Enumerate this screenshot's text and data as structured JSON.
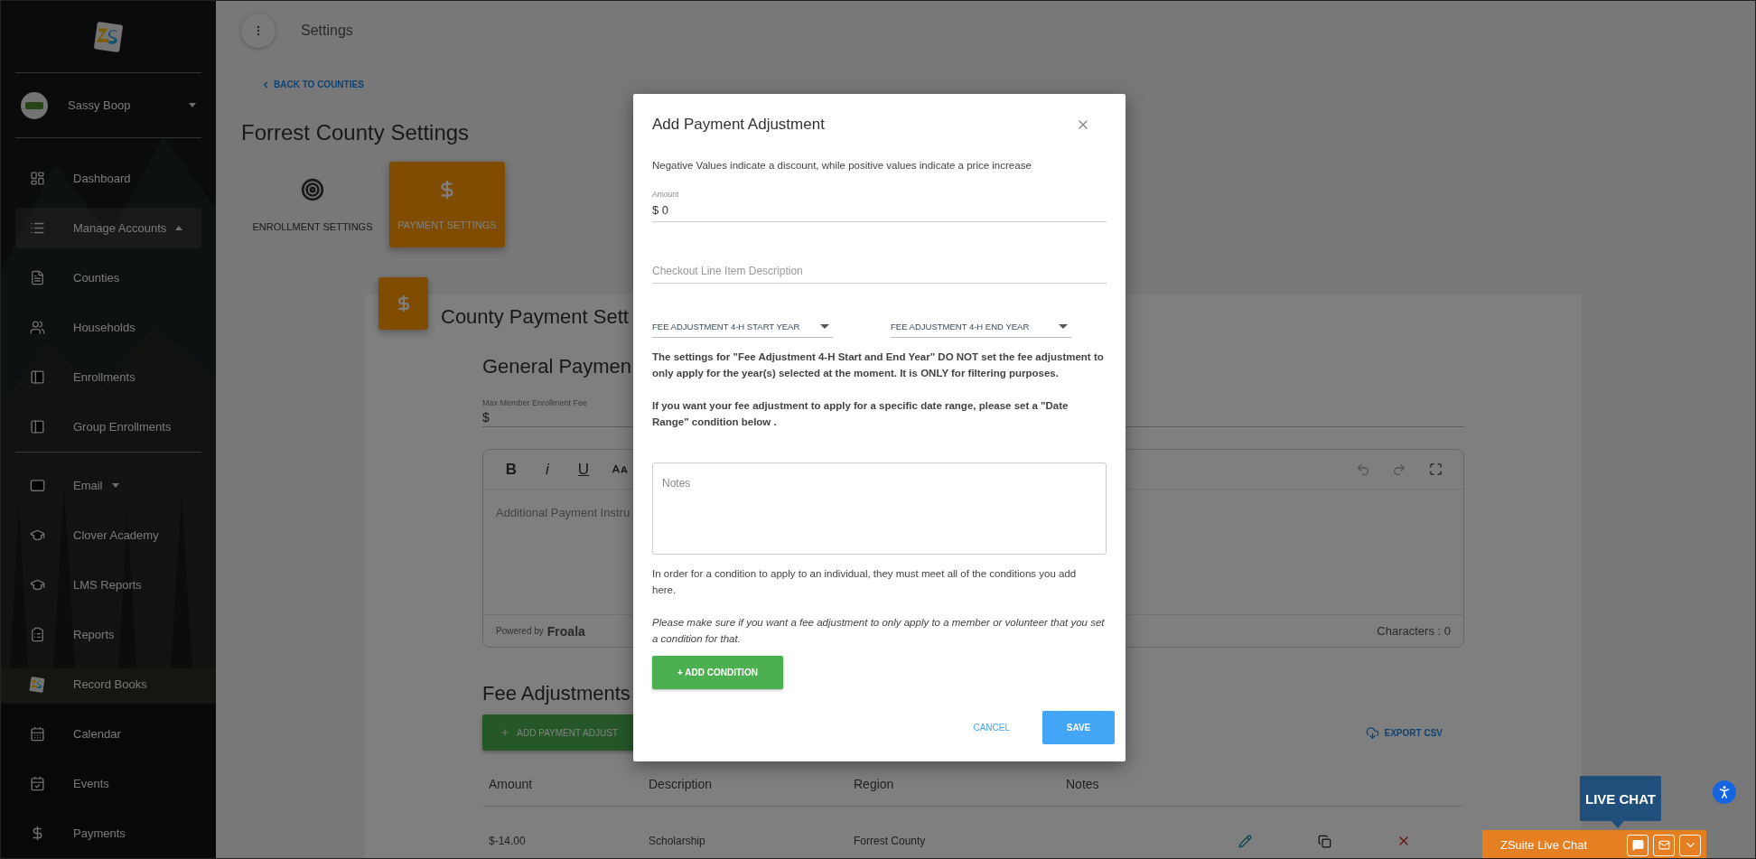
{
  "sidebar": {
    "user": {
      "name": "Sassy Boop"
    },
    "items": [
      {
        "label": "Dashboard",
        "selected": false
      },
      {
        "label": "Manage Accounts",
        "selected": true,
        "expanded": true,
        "children": [
          {
            "label": "Counties",
            "selected": false
          },
          {
            "label": "Households",
            "selected": false
          },
          {
            "label": "Enrollments",
            "selected": false
          },
          {
            "label": "Group Enrollments",
            "selected": false
          }
        ]
      },
      {
        "label": "Email",
        "selected": false,
        "expanded": false
      },
      {
        "label": "Clover Academy",
        "selected": false
      },
      {
        "label": "LMS Reports",
        "selected": false
      },
      {
        "label": "Reports",
        "selected": false
      },
      {
        "label": "Record Books",
        "selected": false
      },
      {
        "label": "Calendar",
        "selected": false
      },
      {
        "label": "Events",
        "selected": false
      },
      {
        "label": "Payments",
        "selected": false
      }
    ]
  },
  "topbar": {
    "title": "Settings"
  },
  "back_link": "BACK TO COUNTIES",
  "page_title": "Forrest County Settings",
  "tabs": [
    {
      "label": "ENROLLMENT SETTINGS",
      "selected": false
    },
    {
      "label": "PAYMENT SETTINGS",
      "selected": true
    }
  ],
  "card": {
    "title": "County Payment Sett",
    "section_title": "General Paymen",
    "max_fee": {
      "label": "Max Member Enrollment Fee",
      "prefix": "$"
    },
    "editor": {
      "toolbar": [
        {
          "kind": "bold",
          "label": "B"
        },
        {
          "kind": "italic",
          "label": "i"
        },
        {
          "kind": "underline",
          "label": "U"
        }
      ],
      "placeholder": "Additional Payment Instru",
      "powered_by": "Powered by",
      "brand": "Froala",
      "counter": "Characters : 0"
    },
    "fee_adjustments": {
      "title": "Fee Adjustments",
      "add_button": "ADD PAYMENT ADJUST",
      "export": "EXPORT CSV",
      "columns": [
        "Amount",
        "Description",
        "Region",
        "Notes"
      ],
      "rows": [
        {
          "amount": "$-14.00",
          "description": "Scholarship",
          "region": "Forrest County"
        }
      ]
    }
  },
  "modal": {
    "title": "Add Payment Adjustment",
    "intro": "Negative Values indicate a discount, while positive values indicate a price increase",
    "amount": {
      "label": "Amount",
      "prefix": "$",
      "value": "0"
    },
    "description": {
      "placeholder": "Checkout Line Item Description"
    },
    "selects": [
      {
        "label": "FEE ADJUSTMENT 4-H START YEAR"
      },
      {
        "label": "FEE ADJUSTMENT 4-H END YEAR"
      }
    ],
    "notices": [
      "The settings for \"Fee Adjustment 4-H Start and End Year\" DO NOT set the fee adjustment to only apply for the year(s) selected at the moment. It is ONLY for filtering purposes.",
      "If you want your fee adjustment to apply for a specific date range, please set a \"Date Range\" condition below ."
    ],
    "notes": {
      "placeholder": "Notes"
    },
    "condition_info": "In order for a condition to apply to an individual, they must meet all of the conditions you add here.",
    "condition_hint": "Please make sure if you want a fee adjustment to only apply to a member or volunteer that you set a condition for that.",
    "add_condition": "+ ADD CONDITION",
    "cancel": "CANCEL",
    "save": "SAVE"
  },
  "live_chat": {
    "bubble": "LIVE CHAT",
    "bar": "ZSuite Live Chat"
  }
}
